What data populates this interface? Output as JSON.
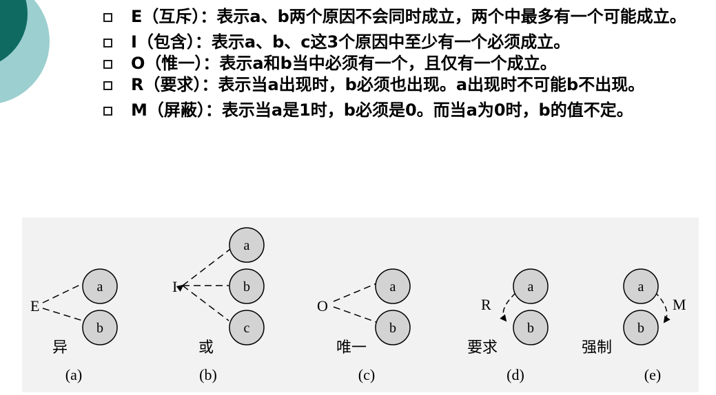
{
  "bullets": [
    {
      "key": "E",
      "text": "E（互斥）：表示a、b两个原因不会同时成立，两个中最多有一个可能成立。"
    },
    {
      "key": "I",
      "text": "I（包含）：表示a、b、c这3个原因中至少有一个必须成立。"
    },
    {
      "key": "O",
      "text": "O（惟一）：表示a和b当中必须有一个，且仅有一个成立。"
    },
    {
      "key": "R",
      "text": "R（要求）：表示当a出现时，b必须也出现。a出现时不可能b不出现。"
    },
    {
      "key": "M",
      "text": "M（屏蔽）：表示当a是1时，b必须是0。而当a为0时，b的值不定。"
    }
  ],
  "diagrams": [
    {
      "symbol": "E",
      "nodes": [
        "a",
        "b"
      ],
      "caption": "异",
      "label": "(a)"
    },
    {
      "symbol": "I",
      "nodes": [
        "a",
        "b",
        "c"
      ],
      "caption": "或",
      "label": "(b)"
    },
    {
      "symbol": "O",
      "nodes": [
        "a",
        "b"
      ],
      "caption": "唯一",
      "label": "(c)"
    },
    {
      "symbol": "R",
      "nodes": [
        "a",
        "b"
      ],
      "caption": "要求",
      "label": "(d)"
    },
    {
      "symbol": "M",
      "nodes": [
        "a",
        "b"
      ],
      "caption": "强制",
      "label": "(e)"
    }
  ],
  "colors": {
    "deco_light": "#9ccfcf",
    "deco_dark": "#0f6a62",
    "node_fill": "#d3d3d3",
    "panel_bg": "#f2f2f2"
  }
}
